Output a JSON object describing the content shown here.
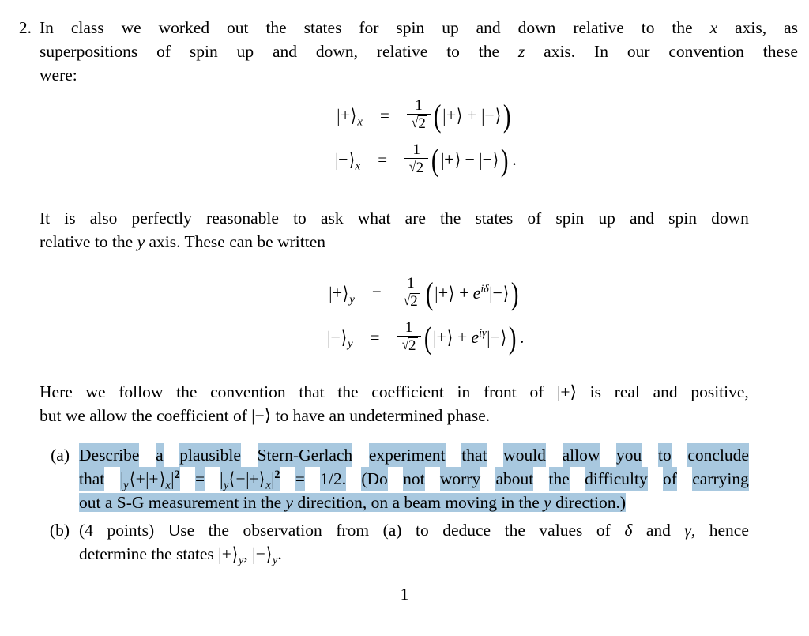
{
  "document": {
    "type": "physics-problem-set",
    "page_number": "1",
    "highlight_color": "#a8c8df",
    "background_color": "#ffffff",
    "text_color": "#000000"
  },
  "problem": {
    "number": "2.",
    "intro_lines": [
      "In class we worked out the states for spin up and down relative to the x axis, as",
      "superpositions of spin up and down, relative to the z axis. In our convention these",
      "were:"
    ],
    "intro_line1_words": [
      "In",
      "class",
      "we",
      "worked",
      "out",
      "the",
      "states",
      "for",
      "spin",
      "up",
      "and",
      "down",
      "relative",
      "to",
      "the",
      "x",
      "axis,",
      "as"
    ],
    "intro_line2_words": [
      "superpositions",
      "of",
      "spin",
      "up",
      "and",
      "down,",
      "relative",
      "to",
      "the",
      "z",
      "axis.",
      "In",
      "our",
      "convention",
      "these"
    ],
    "intro_line3": "were:"
  },
  "equations_x": {
    "row1": {
      "lhs_bar": "|",
      "lhs_sign": "+",
      "lhs_angle": "⟩",
      "lhs_sub": "x",
      "equals": "=",
      "frac_num": "1",
      "frac_radical": "√",
      "frac_den": "2",
      "open_paren": "(",
      "term1_bar": "|",
      "term1_sign": "+",
      "term1_angle": "⟩",
      "operator": "+",
      "term2_bar": "|",
      "term2_sign": "−",
      "term2_angle": "⟩",
      "close_paren": ")",
      "trailing": ""
    },
    "row2": {
      "lhs_bar": "|",
      "lhs_sign": "−",
      "lhs_angle": "⟩",
      "lhs_sub": "x",
      "equals": "=",
      "frac_num": "1",
      "frac_radical": "√",
      "frac_den": "2",
      "open_paren": "(",
      "term1_bar": "|",
      "term1_sign": "+",
      "term1_angle": "⟩",
      "operator": "−",
      "term2_bar": "|",
      "term2_sign": "−",
      "term2_angle": "⟩",
      "close_paren": ")",
      "trailing": "."
    }
  },
  "middle_paragraph": {
    "line1_words": [
      "It",
      "is",
      "also",
      "perfectly",
      "reasonable",
      "to",
      "ask",
      "what",
      "are",
      "the",
      "states",
      "of",
      "spin",
      "up",
      "and",
      "spin",
      "down"
    ],
    "line2_pre": "relative to the ",
    "line2_italic": "y",
    "line2_post": " axis. These can be written"
  },
  "equations_y": {
    "row1": {
      "lhs_bar": "|",
      "lhs_sign": "+",
      "lhs_angle": "⟩",
      "lhs_sub": "y",
      "equals": "=",
      "frac_num": "1",
      "frac_radical": "√",
      "frac_den": "2",
      "open_paren": "(",
      "term1_bar": "|",
      "term1_sign": "+",
      "term1_angle": "⟩",
      "operator": "+",
      "phase_base": "e",
      "phase_exp": "iδ",
      "term2_bar": "|",
      "term2_sign": "−",
      "term2_angle": "⟩",
      "close_paren": ")",
      "trailing": ""
    },
    "row2": {
      "lhs_bar": "|",
      "lhs_sign": "−",
      "lhs_angle": "⟩",
      "lhs_sub": "y",
      "equals": "=",
      "frac_num": "1",
      "frac_radical": "√",
      "frac_den": "2",
      "open_paren": "(",
      "term1_bar": "|",
      "term1_sign": "+",
      "term1_angle": "⟩",
      "operator": "+",
      "phase_base": "e",
      "phase_exp": "iγ",
      "term2_bar": "|",
      "term2_sign": "−",
      "term2_angle": "⟩",
      "close_paren": ")",
      "trailing": "."
    }
  },
  "convention_paragraph": {
    "line1_pre_words": [
      "Here",
      "we",
      "follow",
      "the",
      "convention",
      "that",
      "the",
      "coefficient",
      "in",
      "front",
      "of"
    ],
    "line1_ket": "|+⟩",
    "line1_post_words": [
      "is",
      "real",
      "and",
      "positive,"
    ],
    "line2_pre": "but we allow the coefficient of ",
    "line2_ket": "|−⟩",
    "line2_post": " to have an undetermined phase."
  },
  "part_a": {
    "label": "(a)",
    "line1_words": [
      "Describe",
      "a",
      "plausible",
      "Stern-Gerlach",
      "experiment",
      "that",
      "would",
      "allow",
      "you",
      "to",
      "conclude"
    ],
    "line2": {
      "word_that": "that",
      "math": {
        "outer_bar_open": "|",
        "sub_y": "y",
        "bra_angle": "⟨",
        "bra_sign": "+",
        "mid_bar": "|",
        "ket_sign": "+",
        "ket_angle": "⟩",
        "sub_x": "x",
        "outer_bar_close": "|",
        "power": "2",
        "equals1": "=",
        "outer_bar_open2": "|",
        "sub_y2": "y",
        "bra_angle2": "⟨",
        "bra_sign2": "−",
        "mid_bar2": "|",
        "ket_sign2": "+",
        "ket_angle2": "⟩",
        "sub_x2": "x",
        "outer_bar_close2": "|",
        "power2": "2",
        "equals2": "=",
        "value": "1/2."
      },
      "tail_words": [
        "(Do",
        "not",
        "worry",
        "about",
        "the",
        "difficulty",
        "of",
        "carrying"
      ]
    },
    "line3": {
      "pre": "out a S-G measurement in the ",
      "italic1": "y",
      "mid": " direcition, on a beam moving in the ",
      "italic2": "y",
      "post": " direction.)"
    }
  },
  "part_b": {
    "label": "(b)",
    "line1_words": [
      "(4",
      "points)",
      "Use",
      "the",
      "observation",
      "from",
      "(a)",
      "to",
      "deduce",
      "the",
      "values",
      "of"
    ],
    "line1_delta": "δ",
    "line1_and": "and",
    "line1_gamma": "γ,",
    "line1_hence": "hence",
    "line2_pre": "determine the states ",
    "line2_ket1_bar": "|",
    "line2_ket1_sign": "+",
    "line2_ket1_angle": "⟩",
    "line2_ket1_sub": "y",
    "line2_comma": ", ",
    "line2_ket2_bar": "|",
    "line2_ket2_sign": "−",
    "line2_ket2_angle": "⟩",
    "line2_ket2_sub": "y",
    "line2_period": "."
  },
  "footer": {
    "page_number": "1"
  }
}
